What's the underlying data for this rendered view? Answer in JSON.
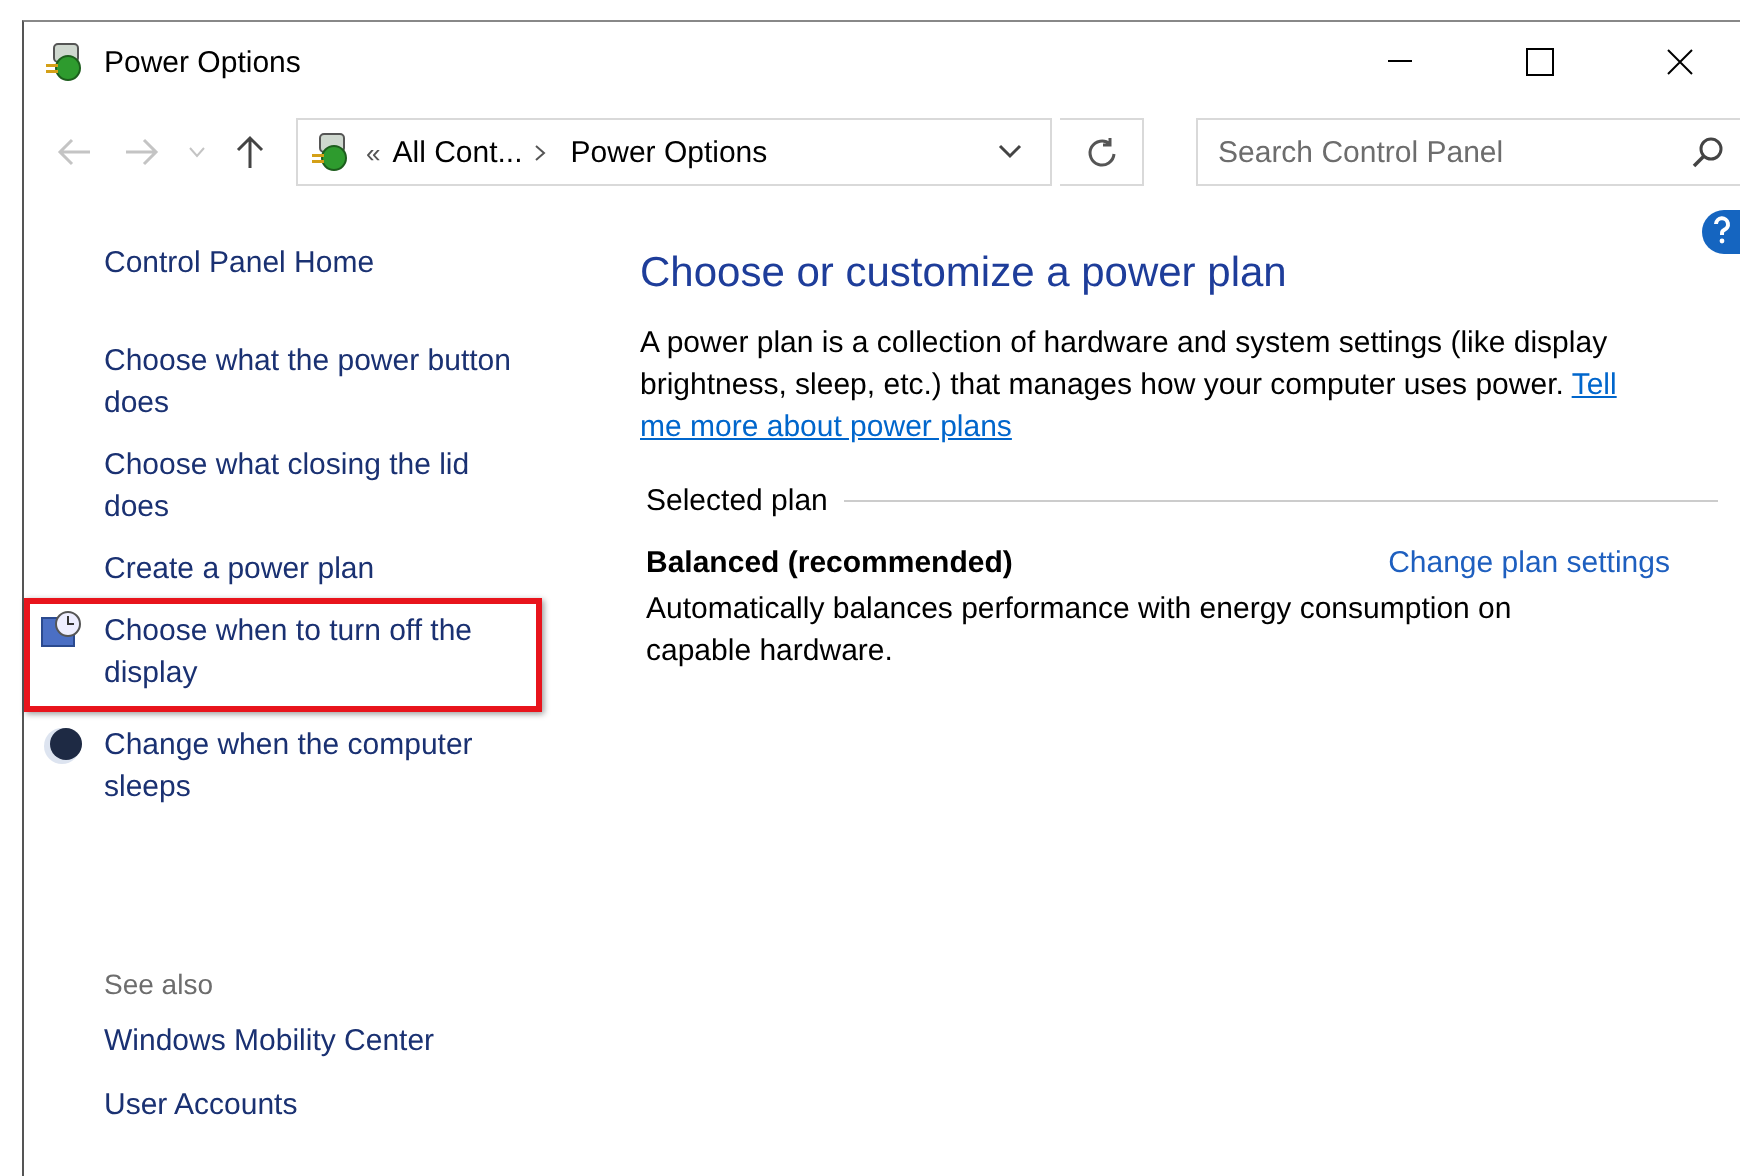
{
  "window": {
    "title": "Power Options"
  },
  "address": {
    "overflow": "«",
    "crumbs": [
      "All Cont...",
      "Power Options"
    ]
  },
  "search": {
    "placeholder": "Search Control Panel"
  },
  "sidebar": {
    "home": "Control Panel Home",
    "items": [
      {
        "label": "Choose what the power button does",
        "kind": "link",
        "highlighted": false
      },
      {
        "label": "Choose what closing the lid does",
        "kind": "link",
        "highlighted": false
      },
      {
        "label": "Create a power plan",
        "kind": "link",
        "highlighted": false
      },
      {
        "label": "Choose when to turn off the display",
        "kind": "display",
        "highlighted": true
      },
      {
        "label": "Change when the computer sleeps",
        "kind": "sleep",
        "highlighted": false
      }
    ],
    "see_also": {
      "heading": "See also",
      "links": [
        "Windows Mobility Center",
        "User Accounts"
      ]
    }
  },
  "main": {
    "heading": "Choose or customize a power plan",
    "description": "A power plan is a collection of hardware and system settings (like display brightness, sleep, etc.) that manages how your computer uses power.",
    "link_lines": [
      "Tell",
      "me more about power plans"
    ],
    "group_label": "Selected plan",
    "plan": {
      "name": "Balanced (recommended)",
      "settings_link": "Change plan settings",
      "description": "Automatically balances performance with energy consumption on capable hardware."
    }
  }
}
